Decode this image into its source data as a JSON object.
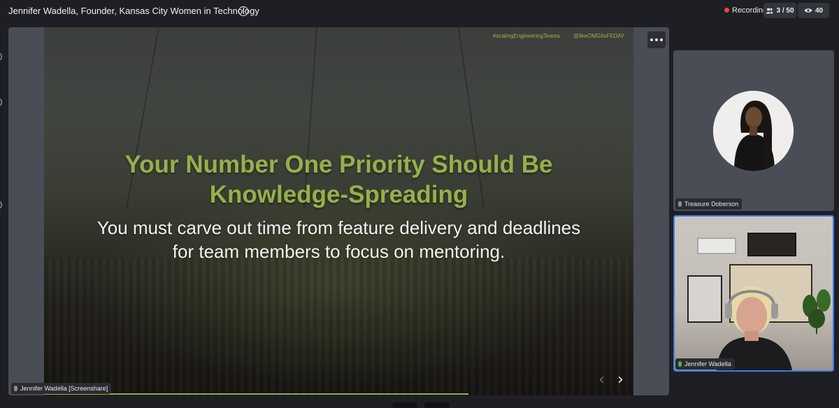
{
  "header": {
    "title": "Jennifer Wadella, Founder, Kansas City Women in Technology",
    "recording_label": "Recording",
    "participants_count": "3 / 50",
    "viewers_count": "40"
  },
  "slide": {
    "hashtag": "#scalingEngineeringTeams",
    "handle": "@likeOMGitsFEDAY",
    "heading_line1": "Your Number One Priority Should Be",
    "heading_line2": "Knowledge-Spreading",
    "body_line1": "You must carve out time from feature delivery and deadlines",
    "body_line2": "for team members to focus on mentoring.",
    "progress_fraction": 0.72
  },
  "screenshare": {
    "name_tag": "Jennifer Wadella [Screenshare]"
  },
  "participants": [
    {
      "name": "Treasure Doberson"
    },
    {
      "name": "Jennifer Wadella"
    }
  ],
  "colors": {
    "accent_green": "#94b14a",
    "active_speaker": "#3f7be6",
    "recording_dot": "#e5483f"
  }
}
